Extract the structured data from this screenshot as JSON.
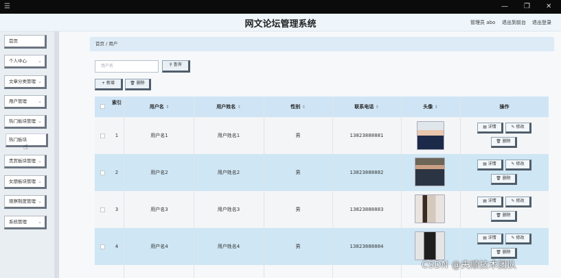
{
  "window": {
    "menu_icon": "hamburger-icon",
    "minimize": "—",
    "maximize": "❐",
    "close": "✕"
  },
  "header": {
    "title": "网文论坛管理系统",
    "admin_label": "管理员 abo",
    "back_label": "退出到前台",
    "logout_label": "退出登录"
  },
  "sidebar": {
    "items": [
      {
        "label": "首页",
        "chevron": ""
      },
      {
        "label": "个人中心",
        "chevron": "⌄"
      },
      {
        "label": "文章分类管理",
        "chevron": "⌄"
      },
      {
        "label": "用户管理",
        "chevron": "⌄"
      },
      {
        "label": "热门板块管理",
        "chevron": "⌄"
      },
      {
        "label": "热门板块",
        "chevron": ""
      },
      {
        "label": "贵宾板块管理",
        "chevron": "⌄"
      },
      {
        "label": "女朋板块管理",
        "chevron": "⌄"
      },
      {
        "label": "观察制度管理",
        "chevron": "⌄"
      },
      {
        "label": "系统管理",
        "chevron": "⌄"
      }
    ]
  },
  "breadcrumb": {
    "home": "首页",
    "sep": "/",
    "current": "用户"
  },
  "search": {
    "placeholder": "用户名",
    "button": "查询",
    "button_icon": "search-icon"
  },
  "actions": {
    "add": "新增",
    "add_icon": "plus-icon",
    "delete": "删除",
    "delete_icon": "trash-icon"
  },
  "table": {
    "columns": [
      "索引",
      "用户名",
      "用户姓名",
      "性别",
      "联系电话",
      "头像",
      "操作"
    ],
    "sort_glyph": "⇕",
    "op_detail": "详情",
    "op_edit": "修改",
    "op_delete": "删除",
    "rows": [
      {
        "index": "1",
        "username": "用户名1",
        "name": "用户姓名1",
        "gender": "男",
        "phone": "13823888881",
        "avatar_colors": [
          "#dfe6ec",
          "#1c2a4a",
          "#e8c7ad"
        ]
      },
      {
        "index": "2",
        "username": "用户名2",
        "name": "用户姓名2",
        "gender": "男",
        "phone": "13823888882",
        "avatar_colors": [
          "#6c6558",
          "#2b3442",
          "#caa085"
        ]
      },
      {
        "index": "3",
        "username": "用户名3",
        "name": "用户姓名3",
        "gender": "男",
        "phone": "13823888883",
        "avatar_colors": [
          "#e9e4e0",
          "#d5c8bd",
          "#3b2a22"
        ]
      },
      {
        "index": "4",
        "username": "用户名4",
        "name": "用户姓名4",
        "gender": "男",
        "phone": "13823888884",
        "avatar_colors": [
          "#e5e5e5",
          "#1e1e1e",
          "#d9b59a"
        ]
      }
    ]
  },
  "watermark": "CSDN @央顺技术团队"
}
